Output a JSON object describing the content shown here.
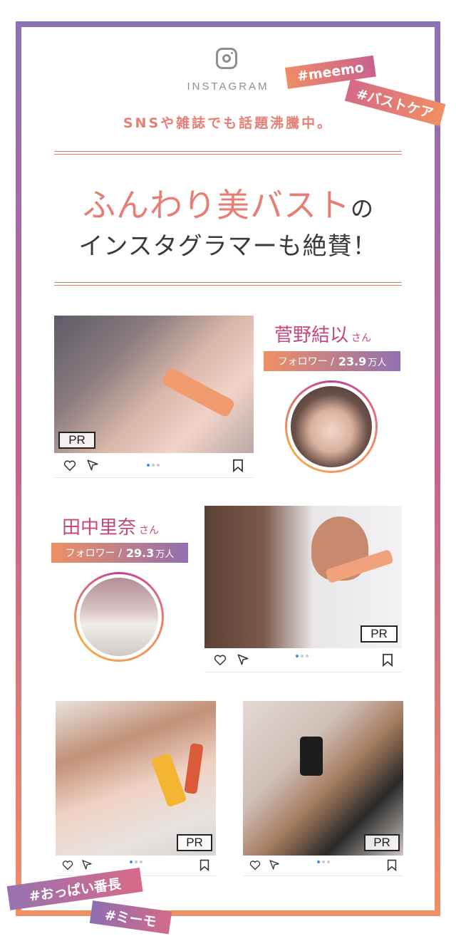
{
  "header": {
    "ig_label": "INSTAGRAM",
    "tags_top": [
      "#meemo",
      "#バストケア"
    ],
    "sns_line": "SNSや雑誌でも話題沸騰中。",
    "headline_pink": "ふんわり美バスト",
    "headline_no": "の",
    "headline_line2": "インスタグラマーも絶賛！"
  },
  "posts": [
    {
      "pr": "PR"
    },
    {
      "pr": "PR"
    },
    {
      "pr": "PR"
    },
    {
      "pr": "PR"
    }
  ],
  "influencers": [
    {
      "name": "菅野結以",
      "suffix": "さん",
      "followers_label": "フォロワー /",
      "followers_count": "23.9",
      "followers_unit": "万人"
    },
    {
      "name": "田中里奈",
      "suffix": "さん",
      "followers_label": "フォロワー /",
      "followers_count": "29.3",
      "followers_unit": "万人"
    }
  ],
  "tags_bottom": [
    "#おっぱい番長",
    "#ミーモ"
  ],
  "colors": {
    "accent_pink": "#e57e74",
    "name_pink": "#c5477a",
    "gradient_start": "#8a72b4",
    "gradient_end": "#f08f63"
  },
  "icons": [
    "instagram-icon",
    "heart-icon",
    "send-icon",
    "bookmark-icon"
  ]
}
